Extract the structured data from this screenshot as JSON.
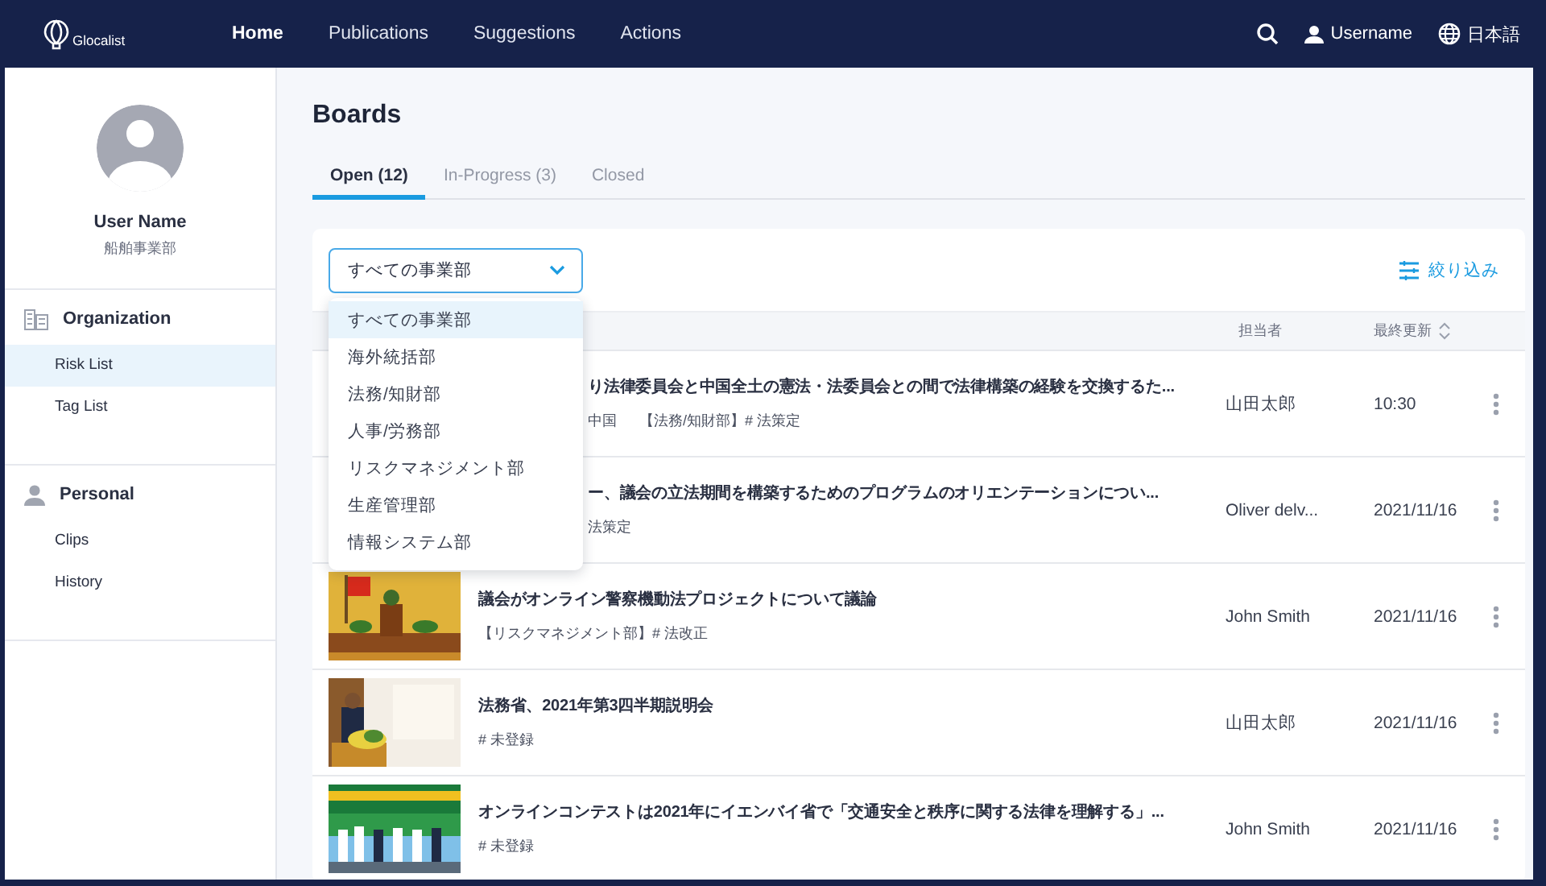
{
  "nav": {
    "logo": "Glocalist",
    "items": [
      {
        "label": "Home",
        "selected": true
      },
      {
        "label": "Publications",
        "selected": false
      },
      {
        "label": "Suggestions",
        "selected": false
      },
      {
        "label": "Actions",
        "selected": false
      }
    ],
    "user": "Username",
    "language": "日本語"
  },
  "profile": {
    "name": "User Name",
    "department": "船舶事業部"
  },
  "sidebar": {
    "sections": [
      {
        "kind": "organization",
        "title": "Organization",
        "items": [
          {
            "label": "Risk List",
            "selected": true
          },
          {
            "label": "Tag List",
            "selected": false
          }
        ]
      },
      {
        "kind": "personal",
        "title": "Personal",
        "items": [
          {
            "label": "Clips",
            "selected": false
          },
          {
            "label": "History",
            "selected": false
          }
        ]
      }
    ]
  },
  "page": {
    "title": "Boards",
    "tabs": [
      {
        "label": "Open (12)",
        "selected": true
      },
      {
        "label": "In-Progress (3)",
        "selected": false
      },
      {
        "label": "Closed",
        "selected": false
      }
    ]
  },
  "filter": {
    "value": "すべての事業部",
    "expanded": true,
    "button": "絞り込み",
    "options": [
      {
        "label": "すべての事業部",
        "selected": true
      },
      {
        "label": "海外統括部",
        "selected": false
      },
      {
        "label": "法務/知財部",
        "selected": false
      },
      {
        "label": "人事/労務部",
        "selected": false
      },
      {
        "label": "リスクマネジメント部",
        "selected": false
      },
      {
        "label": "生産管理部",
        "selected": false
      },
      {
        "label": "情報システム部",
        "selected": false
      }
    ]
  },
  "table": {
    "columns": [
      {
        "label": "担当者"
      },
      {
        "label": "最終更新",
        "sortable": true
      }
    ],
    "rows": [
      {
        "title": "り法律委員会と中国全土の憲法・法委員会との間で法律構築の経験を交換するた...",
        "tags": [
          "中国",
          "【法務/知財部】# 法策定"
        ],
        "assignee": "山田太郎",
        "updated": "10:30"
      },
      {
        "title": "ー、議会の立法期間を構築するためのプログラムのオリエンテーションについ...",
        "tags": [
          "法策定"
        ],
        "assignee": "Oliver delv...",
        "updated": "2021/11/16"
      },
      {
        "title": "議会がオンライン警察機動法プロジェクトについて議論",
        "tags": [
          "【リスクマネジメント部】# 法改正"
        ],
        "assignee": "John Smith",
        "updated": "2021/11/16",
        "image": {
          "kind": "picture"
        }
      },
      {
        "title": "法務省、2021年第3四半期説明会",
        "tags": [
          "# 未登録"
        ],
        "assignee": "山田太郎",
        "updated": "2021/11/16",
        "image": {
          "kind": "picture"
        }
      },
      {
        "title": "オンラインコンテストは2021年にイエンバイ省で「交通安全と秩序に関する法律を理解する」...",
        "tags": [
          "# 未登録"
        ],
        "assignee": "John Smith",
        "updated": "2021/11/16",
        "image": {
          "kind": "picture"
        }
      }
    ]
  }
}
